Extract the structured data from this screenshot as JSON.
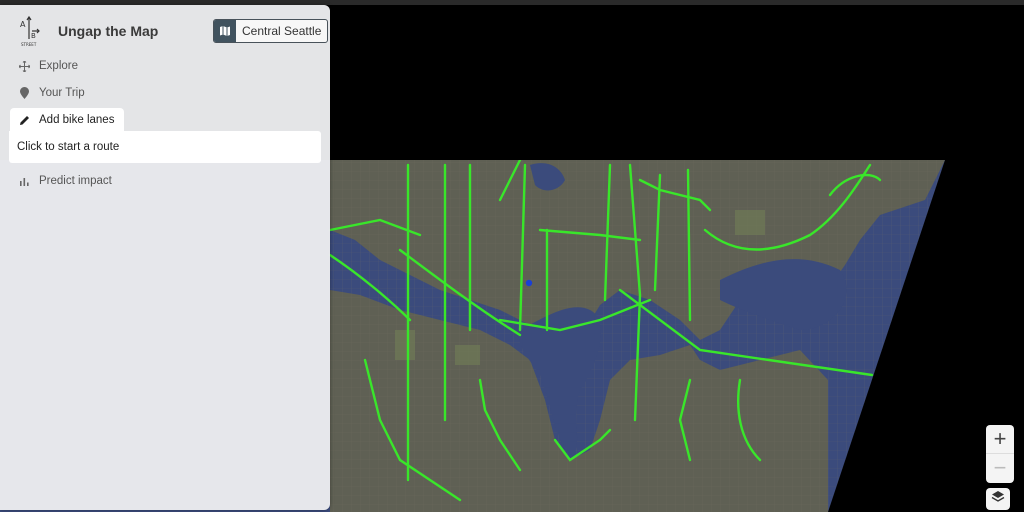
{
  "app": {
    "title": "Ungap the Map",
    "logo_letters": {
      "a": "A",
      "b": "B",
      "caption": "STREET"
    }
  },
  "region": {
    "label": "Central Seattle",
    "icon": "map-icon"
  },
  "nav": {
    "explore": {
      "label": "Explore",
      "icon": "move-icon"
    },
    "trip": {
      "label": "Your Trip",
      "icon": "map-pin-icon"
    },
    "bike_lanes": {
      "label": "Add bike lanes",
      "icon": "pencil-icon"
    },
    "predict": {
      "label": "Predict impact",
      "icon": "bar-chart-icon"
    }
  },
  "route_prompt": "Click to start a route",
  "zoom": {
    "in_label": "+",
    "out_label": "−"
  },
  "layers": {
    "icon": "layers-icon"
  },
  "colors": {
    "panel_bg": "#ebecee",
    "water": "#3a4a7a",
    "land": "#5e6055",
    "bike_lane": "#39e62a",
    "accent": "#41535f"
  }
}
